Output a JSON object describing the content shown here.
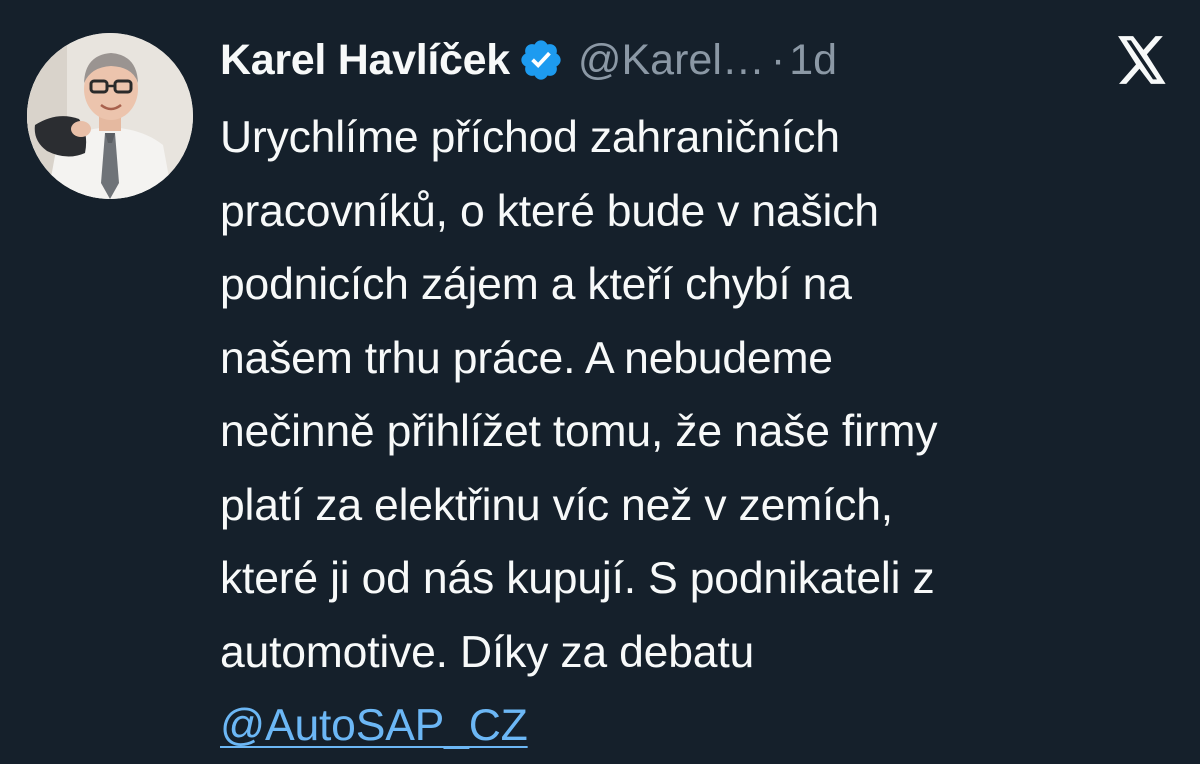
{
  "tweet": {
    "author_name": "Karel Havlíček",
    "handle": "@Karel…",
    "separator": "·",
    "time": "1d",
    "verified_icon": "verified-badge-icon",
    "platform_icon": "x-logo-icon",
    "text_lines": [
      "Urychlíme příchod zahraničních",
      "pracovníků, o které bude v našich",
      "podnicích zájem a kteří chybí na",
      "našem trhu práce. A nebudeme",
      "nečinně přihlížet tomu, že naše firmy",
      "platí za elektřinu víc než v zemích,",
      "které ji od nás kupují. S podnikateli z",
      "automotive. Díky za debatu"
    ],
    "mention": "@AutoSAP_CZ"
  },
  "colors": {
    "background": "#15202b",
    "text": "#f7f9f9",
    "secondary_text": "#8b98a5",
    "link": "#6cb7f5",
    "verified_badge": "#1d9bf0"
  }
}
